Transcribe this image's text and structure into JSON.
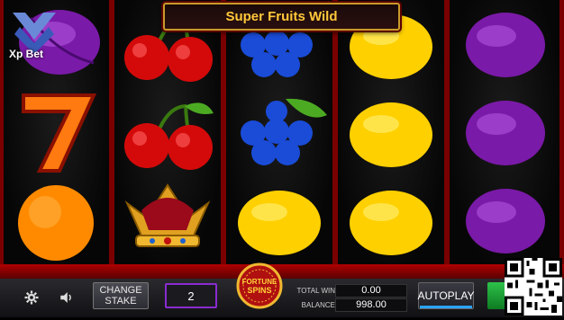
{
  "game": {
    "banner_text": "Super Fruits Wild",
    "brand": "Xp Bet",
    "fortune_logo": [
      "FORTUNE",
      "SPINS"
    ]
  },
  "reels": [
    [
      "plum",
      "seven",
      "orange"
    ],
    [
      "cherry",
      "cherry",
      "crown"
    ],
    [
      "grapes",
      "grapes",
      "lemon"
    ],
    [
      "lemon",
      "lemon",
      "lemon"
    ],
    [
      "plum",
      "plum",
      "plum"
    ]
  ],
  "controls": {
    "settings_icon": "gear-icon",
    "sound_icon": "speaker-icon",
    "change_stake_line1": "CHANGE",
    "change_stake_line2": "STAKE",
    "stake_value": "2",
    "total_win_label": "TOTAL WIN",
    "total_win_value": "0.00",
    "balance_label": "BALANCE",
    "balance_value": "998.00",
    "autoplay_label": "AUTOPLAY"
  },
  "colors": {
    "frame_red": "#7a0000",
    "banner_text": "#ffc83a",
    "stake_border": "#8a2bd0",
    "autoplay_accent": "#2aa3ff",
    "spin_green": "#2ec24a"
  }
}
